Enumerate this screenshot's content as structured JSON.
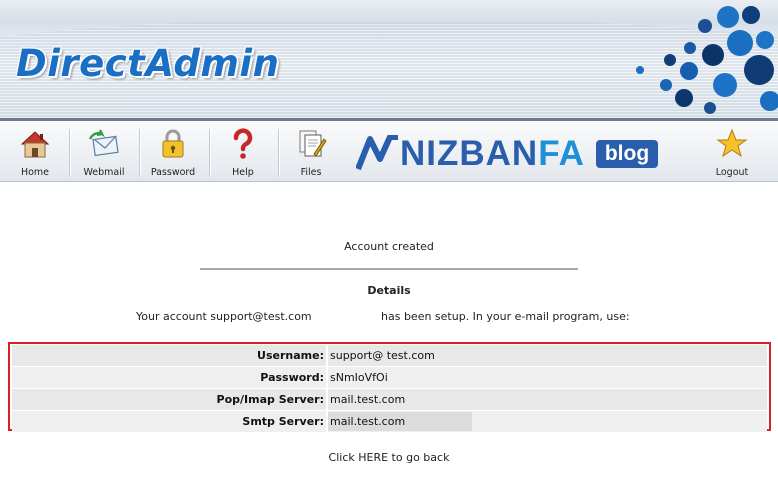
{
  "header": {
    "logo_text": "DirectAdmin"
  },
  "nav": {
    "items": [
      {
        "label": "Home",
        "icon": "house-icon"
      },
      {
        "label": "Webmail",
        "icon": "mail-icon"
      },
      {
        "label": "Password",
        "icon": "lock-icon"
      },
      {
        "label": "Help",
        "icon": "question-mark-icon"
      },
      {
        "label": "Files",
        "icon": "files-icon"
      },
      {
        "label": "Logout",
        "icon": "star-icon"
      }
    ],
    "brand_text_main": "NIZBAN",
    "brand_text_accent": "FA",
    "brand_badge": "blog"
  },
  "content": {
    "status": "Account created",
    "section_title": "Details",
    "account_line_start": "Your account support@test.com",
    "account_line_end": "has been setup. In your e-mail program, use:",
    "rows": [
      {
        "label": "Username:",
        "value": "support@ test.com"
      },
      {
        "label": "Password:",
        "value": "sNmIoVfOi"
      },
      {
        "label": "Pop/Imap Server:",
        "value": "mail.test.com"
      },
      {
        "label": "Smtp Server:",
        "value": "mail.test.com"
      }
    ],
    "back_link": "Click HERE to go back"
  },
  "colors": {
    "logo_blue": "#1a6fc4",
    "brand_blue": "#2a5dab",
    "highlight_border": "#d9202a"
  }
}
